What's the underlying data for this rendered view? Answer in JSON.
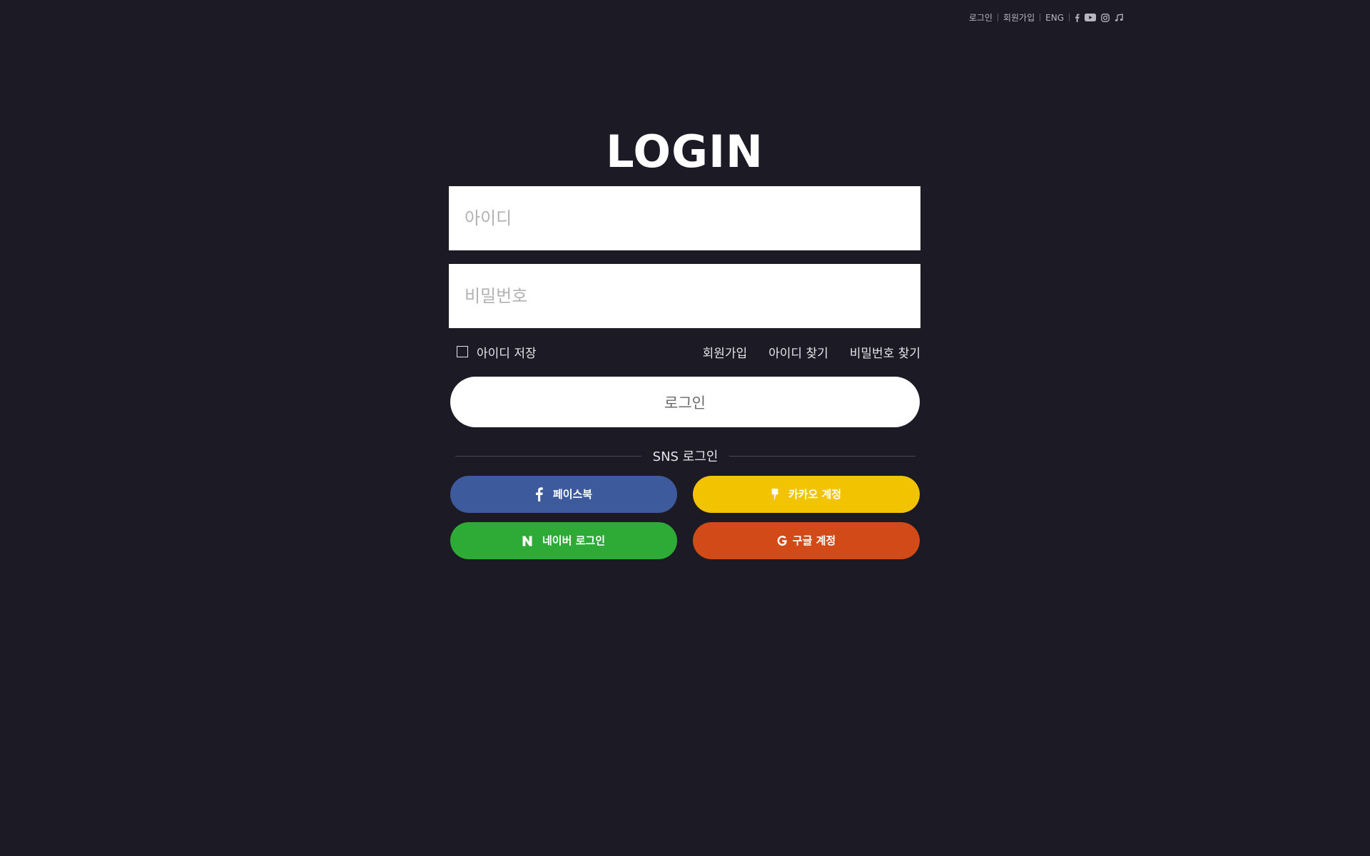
{
  "top_nav": {
    "login": "로그인",
    "signup": "회원가입",
    "lang": "ENG",
    "icons": [
      "facebook-icon",
      "youtube-icon",
      "instagram-icon",
      "music-icon"
    ]
  },
  "login": {
    "title": "LOGIN",
    "id_placeholder": "아이디",
    "pw_placeholder": "비밀번호",
    "save_id_label": "아이디 저장",
    "signup_link": "회원가입",
    "find_id_link": "아이디 찾기",
    "find_pw_link": "비밀번호 찾기",
    "submit_label": "로그인"
  },
  "sns": {
    "divider_label": "SNS 로그인",
    "buttons": [
      {
        "label": "페이스북",
        "color": "#3d5a9c",
        "icon": "facebook-icon"
      },
      {
        "label": "카카오 계정",
        "color": "#f2c300",
        "icon": "kakao-icon"
      },
      {
        "label": "네이버 로그인",
        "color": "#2eaa36",
        "icon": "naver-icon"
      },
      {
        "label": "구글 계정",
        "color": "#d24a17",
        "icon": "google-icon"
      }
    ]
  }
}
